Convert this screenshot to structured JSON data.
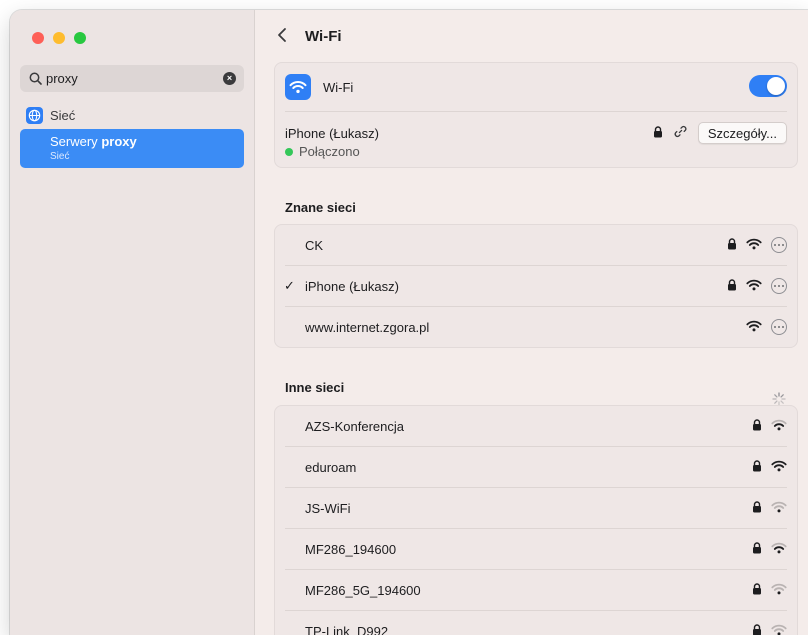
{
  "sidebar": {
    "search": {
      "value": "proxy",
      "placeholder": ""
    },
    "section_label": "Sieć",
    "selected_item": {
      "label_prefix": "Serwery",
      "label_match": "proxy",
      "sublabel": "Sieć"
    }
  },
  "header": {
    "title": "Wi-Fi"
  },
  "wifi": {
    "toggle_label": "Wi-Fi",
    "enabled": true,
    "current_network": "iPhone (Łukasz)",
    "status": "Połączono",
    "details_button": "Szczegóły..."
  },
  "known_networks": {
    "title": "Znane sieci",
    "items": [
      {
        "name": "CK",
        "checked": false,
        "locked": true,
        "icon": "wifi-icon"
      },
      {
        "name": "iPhone (Łukasz)",
        "checked": true,
        "locked": true,
        "icon": "wifi-icon"
      },
      {
        "name": "www.internet.zgora.pl",
        "checked": false,
        "locked": false,
        "icon": "wifi-icon"
      }
    ]
  },
  "other_networks": {
    "title": "Inne sieci",
    "items": [
      {
        "name": "AZS-Konferencja",
        "locked": true,
        "strength": "medium"
      },
      {
        "name": "eduroam",
        "locked": true,
        "strength": "strong"
      },
      {
        "name": "JS-WiFi",
        "locked": true,
        "strength": "weak"
      },
      {
        "name": "MF286_194600",
        "locked": true,
        "strength": "medium"
      },
      {
        "name": "MF286_5G_194600",
        "locked": true,
        "strength": "weak"
      },
      {
        "name": "TP-Link_D992",
        "locked": true,
        "strength": "weak"
      }
    ]
  },
  "colors": {
    "accent": "#2f7ff5",
    "selection": "#3b8cf5",
    "connected": "#34c759"
  }
}
